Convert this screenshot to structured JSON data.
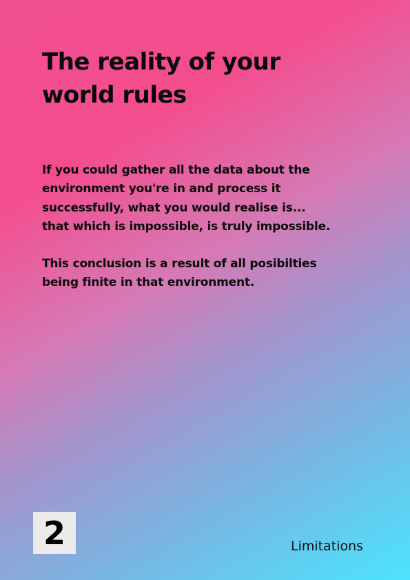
{
  "title": "The reality of your world rules",
  "paragraphs": [
    "If you could gather all the data about the environment you're in and process it successfully, what you would realise is... that which is impossible, is truly impossible.",
    "This conclusion is a result of all posibilties being finite in that environment."
  ],
  "footer": {
    "page_number": "2",
    "section_label": "Limitations"
  },
  "colors": {
    "gradient_start": "#f24f93",
    "gradient_end": "#4be4fe",
    "page_number_box": "#ebebeb",
    "text": "#0a0a0a"
  }
}
